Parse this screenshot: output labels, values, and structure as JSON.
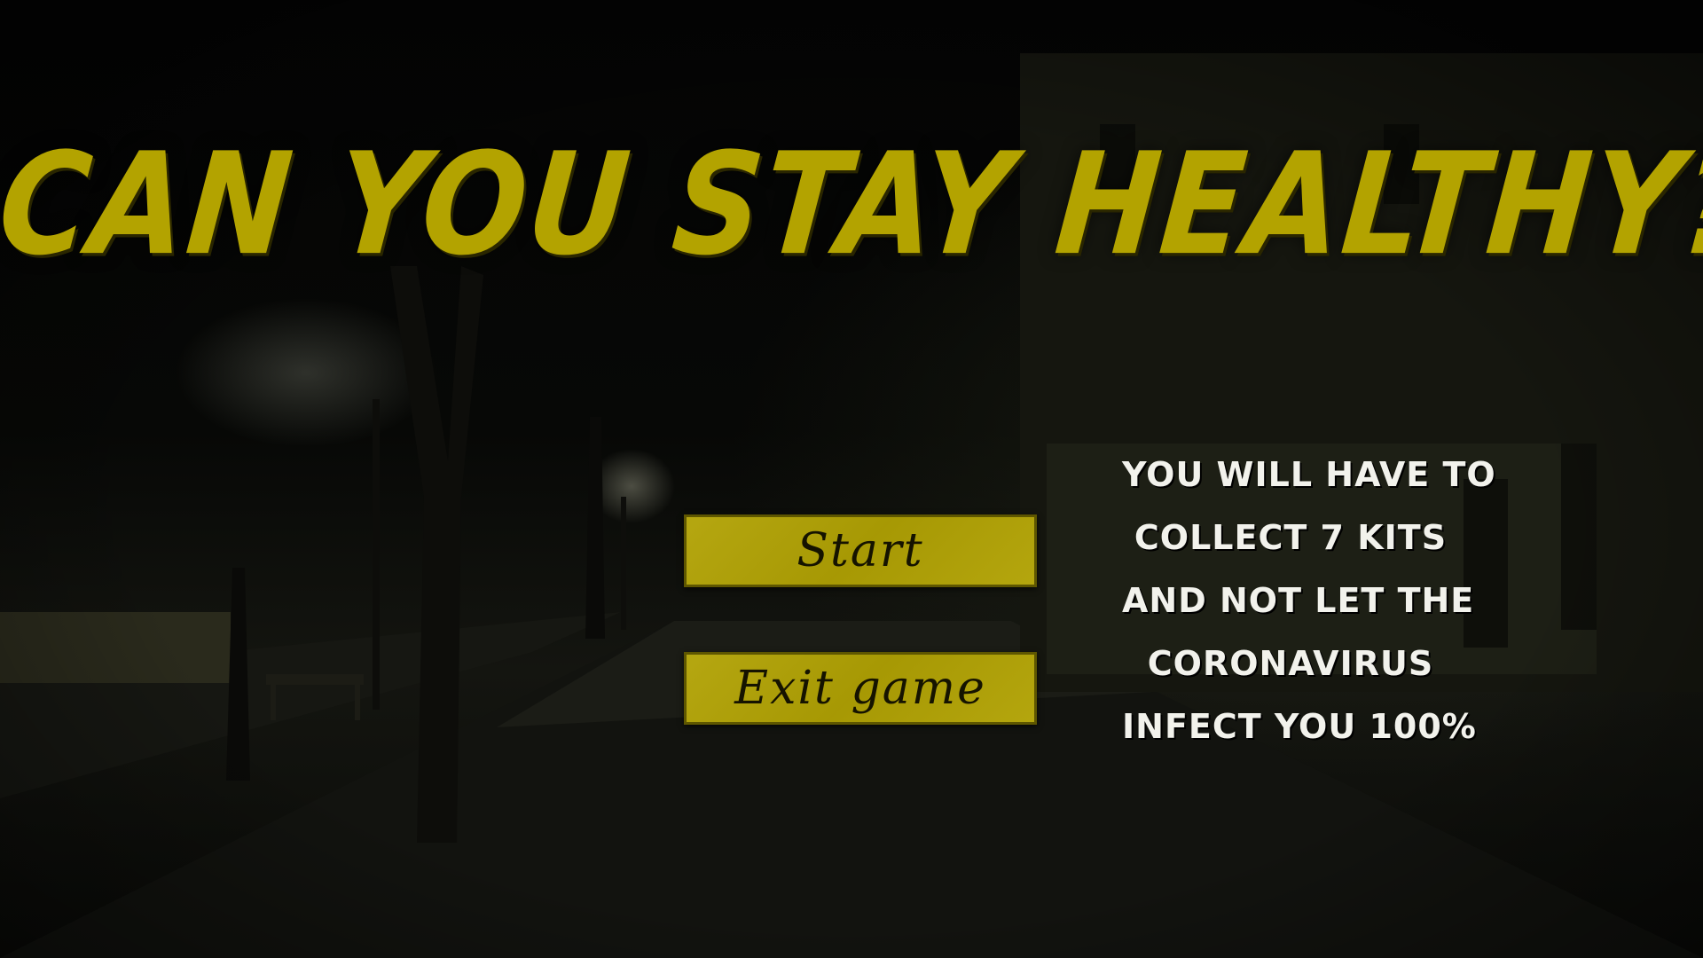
{
  "game": {
    "title": "CAN YOU STAY HEALTHY?",
    "menu": {
      "start_label": "Start",
      "exit_label": "Exit game"
    },
    "instructions": [
      "YOU WILL HAVE TO",
      "COLLECT 7 KITS",
      "AND NOT LET THE",
      "CORONAVIRUS",
      "INFECT YOU 100%"
    ],
    "colors": {
      "title": "#b3a300",
      "button_fill": "#b1a204",
      "button_text": "#151300",
      "instructions_text": "#f2f2ec"
    }
  }
}
